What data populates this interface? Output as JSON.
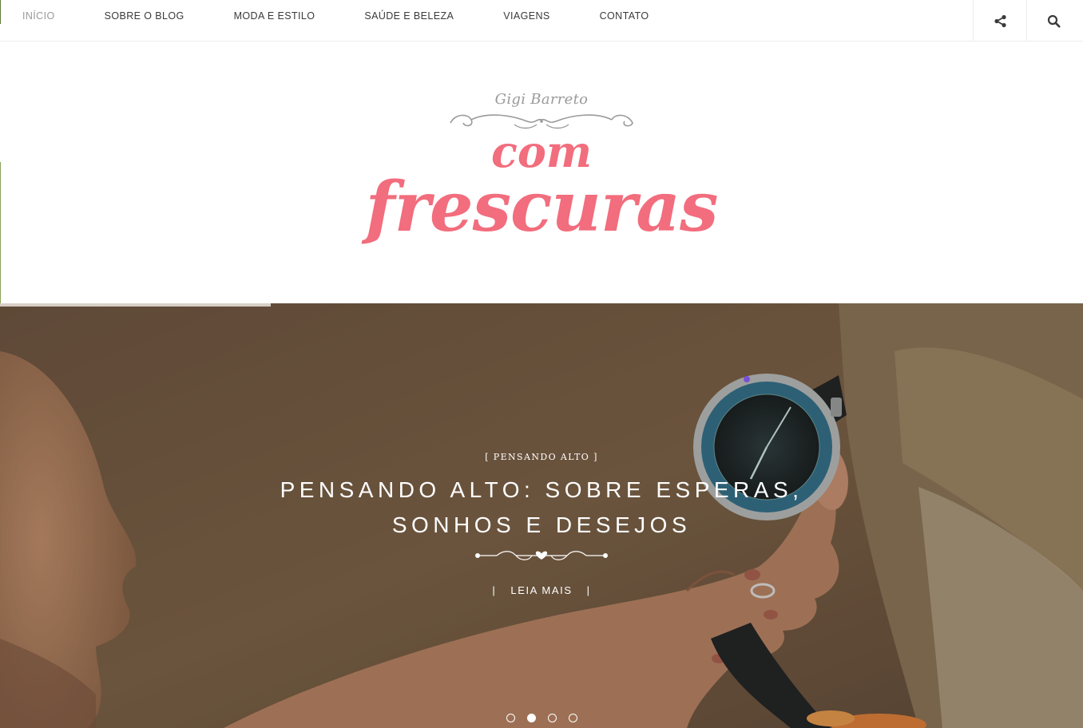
{
  "nav": {
    "items": [
      {
        "label": "INÍCIO",
        "active": true
      },
      {
        "label": "SOBRE O BLOG",
        "active": false
      },
      {
        "label": "MODA E ESTILO",
        "active": false
      },
      {
        "label": "SAÚDE E BELEZA",
        "active": false
      },
      {
        "label": "VIAGENS",
        "active": false
      },
      {
        "label": "CONTATO",
        "active": false
      }
    ],
    "icons": {
      "share": "share-icon",
      "search": "search-icon"
    }
  },
  "logo": {
    "subtitle": "Gigi Barreto",
    "line1": "com",
    "line2": "frescuras"
  },
  "hero": {
    "category": "[ PENSANDO ALTO ]",
    "title_line1": "PENSANDO ALTO: SOBRE ESPERAS,",
    "title_line2": "SONHOS E DESEJOS",
    "cta_label": "LEIA MAIS",
    "cta_separator": "|",
    "slide_progress": 0.25,
    "slides_count": 4,
    "active_slide": 2
  },
  "colors": {
    "brand_pink": "#f26d7d",
    "nav_text": "#3a3a3a",
    "nav_active": "#9a9a9a",
    "hero_text": "#ffffff"
  }
}
